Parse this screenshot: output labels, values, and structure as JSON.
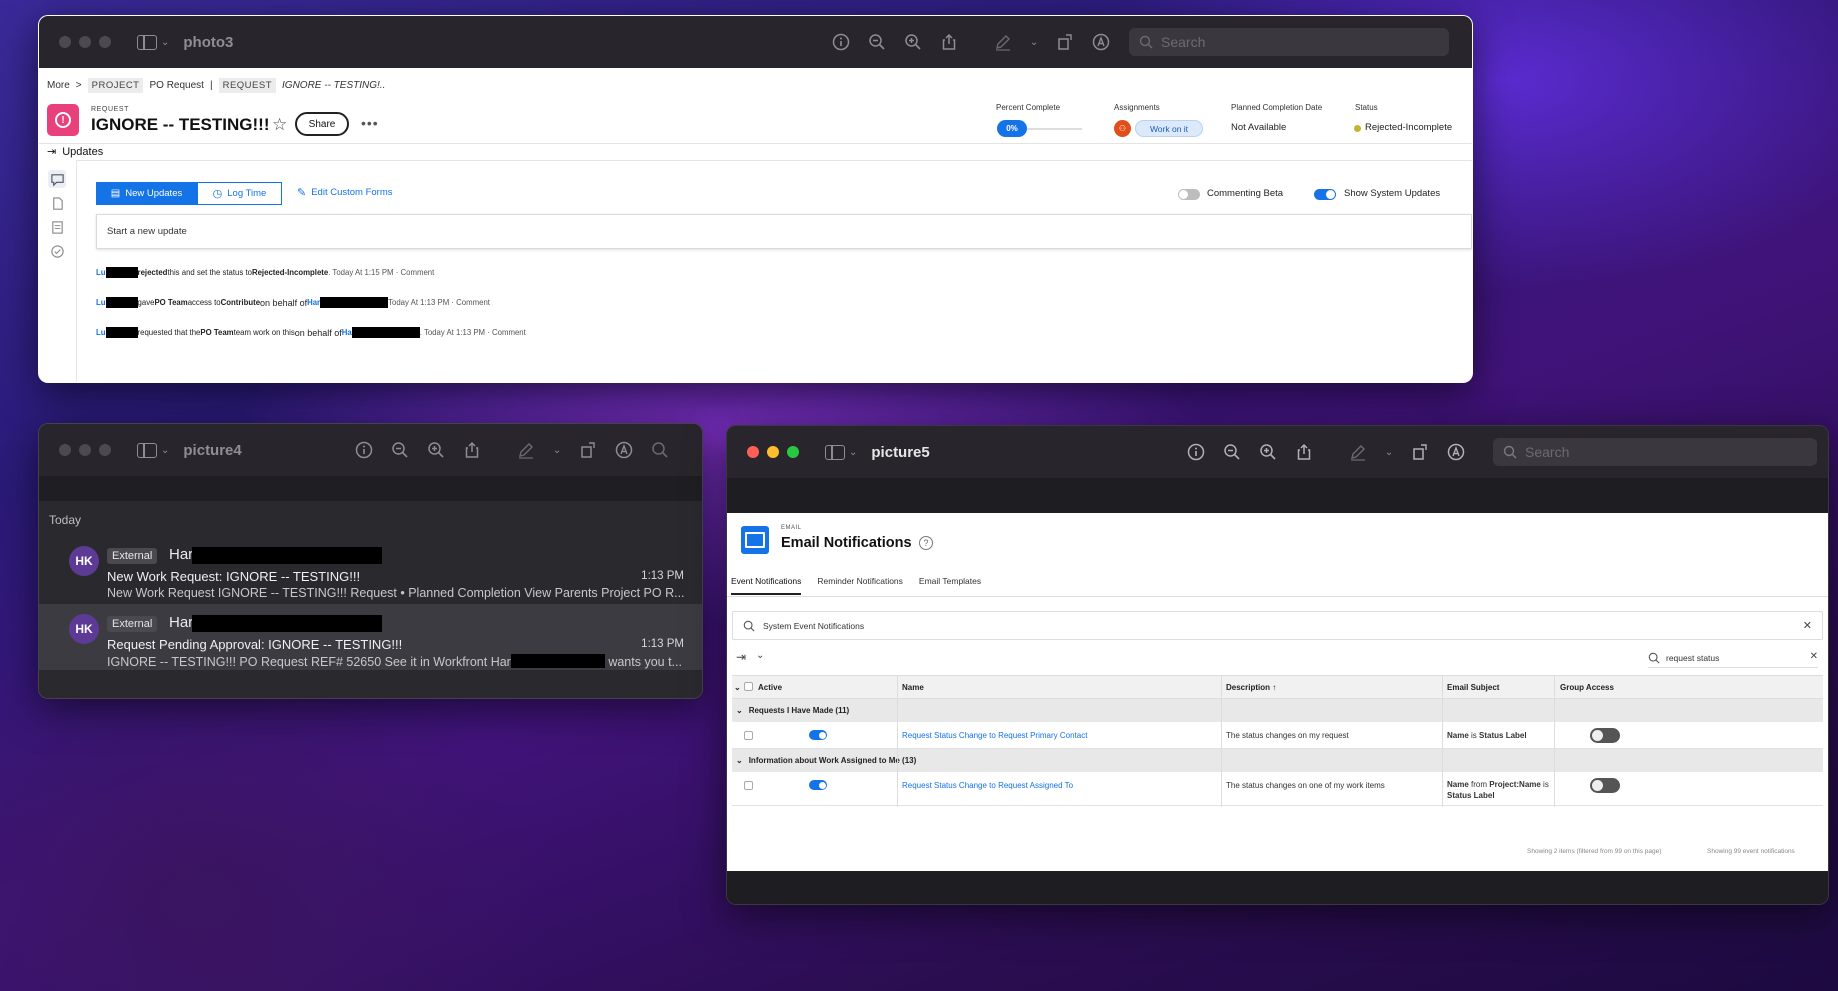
{
  "window1": {
    "title": "photo3",
    "search_placeholder": "Search",
    "breadcrumb": {
      "more": "More",
      "sep": ">",
      "project_tag": "PROJECT",
      "project_name": "PO Request",
      "pipe": "|",
      "request_tag": "REQUEST",
      "request_name": "IGNORE -- TESTING!.."
    },
    "request": {
      "type": "REQUEST",
      "title": "IGNORE -- TESTING!!!",
      "share_label": "Share",
      "more": "•••"
    },
    "meta": {
      "percent_label": "Percent Complete",
      "percent_value": "0%",
      "percent_complete": 0,
      "assignments_label": "Assignments",
      "work_on_it": "Work on it",
      "planned_label": "Planned Completion Date",
      "planned_value": "Not Available",
      "status_label": "Status",
      "status_value": "Rejected-Incomplete",
      "status_color": "#c7b42c"
    },
    "updates_header": "Updates",
    "tabs": {
      "new_updates": "New Updates",
      "log_time": "Log Time",
      "edit_forms": "Edit Custom Forms"
    },
    "toggles": {
      "commenting_beta": "Commenting Beta",
      "show_system": "Show System Updates"
    },
    "new_update_placeholder": "Start a new update",
    "feed": [
      {
        "name": "Lu",
        "text1": "rejected",
        "text2": " this and set the status to ",
        "status": "Rejected-Incomplete",
        "time": ". Today At 1:15 PM",
        "comment": "· Comment"
      },
      {
        "name": "Lu",
        "text1": "gave ",
        "team": "PO Team",
        "text2": " access to ",
        "access": "Contribute",
        "behalf": " on behalf of ",
        "who": "Har",
        "time": " Today At 1:13 PM",
        "comment": "· Comment"
      },
      {
        "name": "Lu",
        "text1": "requested that the ",
        "team": "PO Team",
        "text2": " team work on this ",
        "behalf": "on behalf of ",
        "who": "Ha",
        "time": ". Today At 1:13 PM",
        "comment": "· Comment"
      }
    ]
  },
  "window2": {
    "title": "picture4",
    "section": "Today",
    "messages": [
      {
        "initials": "HK",
        "tag": "External",
        "sender": "Har",
        "subject": "New Work Request: IGNORE -- TESTING!!!",
        "time": "1:13 PM",
        "preview": "New Work Request IGNORE -- TESTING!!! Request • Planned Completion View Parents Project PO R..."
      },
      {
        "initials": "HK",
        "tag": "External",
        "sender": "Har",
        "subject": "Request Pending Approval: IGNORE -- TESTING!!!",
        "time": "1:13 PM",
        "preview_a": "IGNORE -- TESTING!!! PO Request REF# 52650 See it in Workfront Har",
        "preview_b": " wants you t..."
      }
    ]
  },
  "window3": {
    "title": "picture5",
    "search_placeholder": "Search",
    "type": "EMAIL",
    "heading": "Email Notifications",
    "help": "?",
    "tabs": [
      "Event Notifications",
      "Reminder Notifications",
      "Email Templates"
    ],
    "system_search": "System Event Notifications",
    "filter_value": "request status",
    "columns": {
      "active": "Active",
      "name": "Name",
      "description": "Description ↑",
      "subject": "Email Subject",
      "group": "Group Access"
    },
    "groups": [
      {
        "label": "Requests I Have Made (11)",
        "row": {
          "name": "Request Status Change to Request Primary Contact",
          "description": "The status changes on my request",
          "subject_a": "Name",
          "subject_b": " is ",
          "subject_c": "Status Label"
        }
      },
      {
        "label": "Information about Work Assigned to Me (13)",
        "row": {
          "name": "Request Status Change to Request Assigned To",
          "description": "The status changes on one of my work items",
          "subject_a": "Name",
          "subject_b": " from ",
          "subject_c": "Project:Name",
          "subject_d": " is",
          "subject_e": "Status Label"
        }
      }
    ],
    "footer_left": "Showing 2 items (filtered from 99 on this page)",
    "footer_right": "Showing 99 event notifications"
  }
}
